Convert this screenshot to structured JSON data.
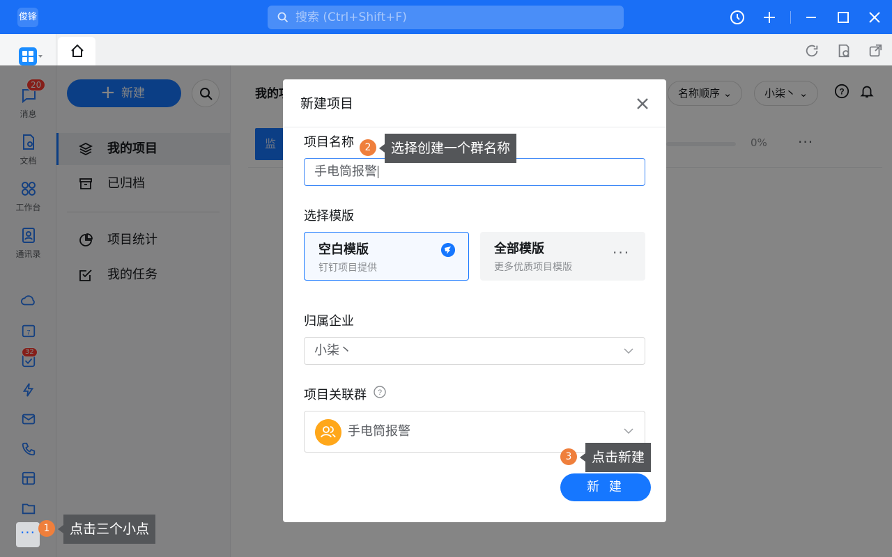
{
  "titlebar": {
    "avatar_text": "俊锋",
    "search_placeholder": "搜索 (Ctrl+Shift+F)"
  },
  "leftrail": {
    "items": [
      {
        "label": "消息",
        "badge": "20"
      },
      {
        "label": "文档"
      },
      {
        "label": "工作台"
      },
      {
        "label": "通讯录"
      }
    ],
    "todo_badge": "32"
  },
  "sidepanel": {
    "new_label": "新建",
    "nav": [
      {
        "label": "我的项目"
      },
      {
        "label": "已归档"
      },
      {
        "label": "项目统计"
      },
      {
        "label": "我的任务"
      }
    ]
  },
  "main": {
    "title": "我的项",
    "sort_label": "名称顺序",
    "org_label": "小柒丶",
    "project_chip": "监",
    "progress_text": "0%",
    "progress": 0
  },
  "dialog": {
    "title": "新建项目",
    "name_label": "项目名称",
    "name_value": "手电筒报警",
    "template_label": "选择模版",
    "templates": [
      {
        "name": "空白模版",
        "sub": "钉钉项目提供"
      },
      {
        "name": "全部模版",
        "sub": "更多优质项目模版"
      }
    ],
    "org_label": "归属企业",
    "org_value": "小柒丶",
    "group_label": "项目关联群",
    "group_value": "手电筒报警",
    "create_label": "新 建"
  },
  "tips": [
    {
      "step": "1",
      "text": "点击三个小点"
    },
    {
      "step": "2",
      "text": "选择创建一个群名称"
    },
    {
      "step": "3",
      "text": "点击新建"
    }
  ]
}
